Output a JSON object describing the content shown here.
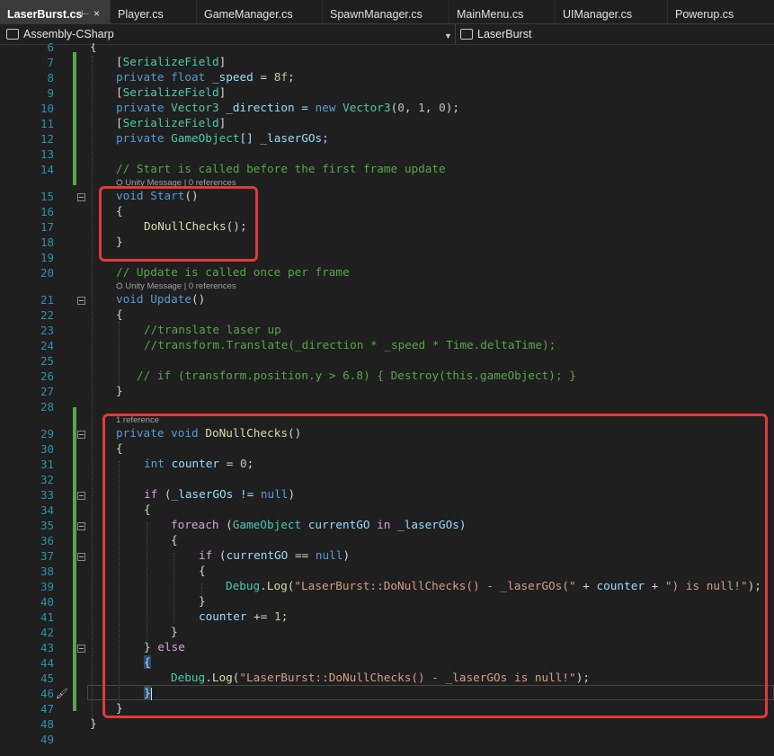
{
  "tabs": [
    {
      "label": "LaserBurst.cs",
      "pin": "⊢",
      "close": "×"
    },
    {
      "label": "Player.cs"
    },
    {
      "label": "GameManager.cs"
    },
    {
      "label": "SpawnManager.cs"
    },
    {
      "label": "MainMenu.cs"
    },
    {
      "label": "UIManager.cs"
    },
    {
      "label": "Powerup.cs"
    }
  ],
  "nav": {
    "project": "Assembly-CSharp",
    "scope": "LaserBurst"
  },
  "codelens": {
    "unity_message": "⛭ Unity Message | 0 references",
    "one_reference": "1 reference"
  },
  "line_numbers": [
    "6",
    "7",
    "8",
    "9",
    "10",
    "11",
    "12",
    "13",
    "14",
    "15",
    "16",
    "17",
    "18",
    "19",
    "20",
    "21",
    "22",
    "23",
    "24",
    "25",
    "26",
    "27",
    "28",
    "29",
    "30",
    "31",
    "32",
    "33",
    "34",
    "35",
    "36",
    "37",
    "38",
    "39",
    "40",
    "41",
    "42",
    "43",
    "44",
    "45",
    "46",
    "47",
    "48",
    "49"
  ],
  "code": {
    "l6": "{",
    "l7a": "[",
    "l7b": "SerializeField",
    "l7c": "]",
    "l8a": "private float ",
    "l8b": "_speed",
    " l8c": "",
    "l8d": " = ",
    "l8e": "8f",
    "l8f": ";",
    "l9a": "[",
    "l9b": "SerializeField",
    "l9c": "]",
    "l10a": "private ",
    "l10b": "Vector3",
    "l10c": " _direction = ",
    "l10d": "new ",
    "l10e": "Vector3",
    "l10f": "(",
    "l10g": "0",
    ", ": "",
    "l10h": "1",
    "l10i": "0",
    "l10j": ");",
    "l11a": "[",
    "l11b": "SerializeField",
    "l11c": "]",
    "l12a": "private ",
    "l12b": "GameObject",
    "l12c": "[] _laserGOs;",
    "l14": "// Start is called before the first frame update",
    "l15a": "void ",
    "l15b": "Start",
    "l15c": "()",
    "l16": "{",
    "l17a": "DoNullChecks",
    "l17b": "();",
    "l18": "}",
    "l20": "// Update is called once per frame",
    "l21a": "void ",
    "l21b": "Update",
    "l21c": "()",
    "l22": "{",
    "l23": "//translate laser up",
    "l24": "//transform.Translate(_direction * _speed * Time.deltaTime);",
    "l26": "// if (transform.position.y > 6.8) { Destroy(this.gameObject); }",
    "l27": "}",
    "l29a": "private void ",
    "l29b": "DoNullChecks",
    "l29c": "()",
    "l30": "{",
    "l31a": "int ",
    "l31b": "counter",
    " l31c": "",
    "l31d": " = ",
    "l31e": "0",
    "l31f": ";",
    "l33a": "if ",
    "l33b": "(_laserGOs != ",
    "l33c": "null",
    "l33d": ")",
    "l34": "{",
    "l35a": "foreach ",
    "l35b": "(",
    "l35c": "GameObject ",
    "l35d": "currentGO ",
    "l35e": "in ",
    "l35f": "_laserGOs)",
    "l36": "{",
    "l37a": "if ",
    "l37b": "(",
    "l37c": "currentGO",
    " l37d": "",
    "l37e": " == ",
    "l37f": "null",
    "l37g": ")",
    "l38": "{",
    "l39a": "Debug",
    "l39b": ".",
    "l39c": "Log",
    "l39d": "(",
    "l39e": "\"LaserBurst::DoNullChecks() - _laserGOs(\"",
    "l39f": " + ",
    "l39g": "counter",
    "l39h": " + ",
    "l39i": "\") is null!\"",
    "l39j": ");",
    "l40": "}",
    "l41a": "counter",
    "l41b": " += ",
    "l41c": "1",
    "l41d": ";",
    "l42": "}",
    "l43a": "} ",
    "l43b": "else",
    "l44": "{",
    "l45a": "Debug",
    "l45b": ".",
    "l45c": "Log",
    "l45d": "(",
    "l45e": "\"LaserBurst::DoNullChecks() - _laserGOs is null!\"",
    "l45f": ");",
    "l46": "}",
    "l47": "}",
    "l48": "}"
  },
  "colors": {
    "keyword": "#569cd6",
    "type": "#4ec9b0",
    "method": "#dcdcaa",
    "string": "#d69d85",
    "comment": "#57a64a",
    "highlight_box": "#e03a3a"
  }
}
